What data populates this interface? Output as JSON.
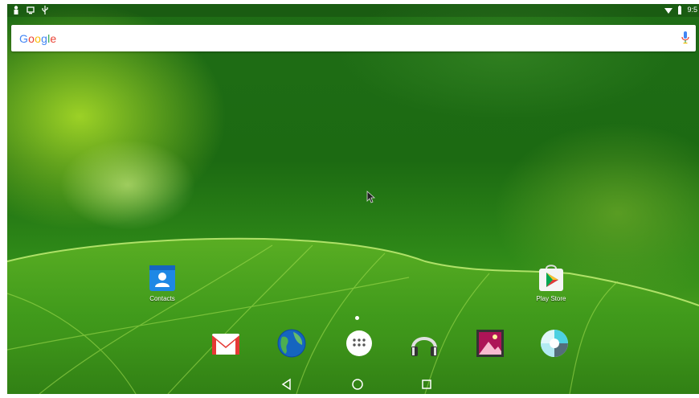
{
  "status_bar": {
    "left_icons": [
      "person-icon",
      "screen-icon",
      "usb-icon"
    ],
    "right_icons": [
      "wifi-icon",
      "battery-icon"
    ],
    "clock": "9:5"
  },
  "search_bar": {
    "logo": "Google",
    "logo_colors": [
      "#4285F4",
      "#EA4335",
      "#FBBC05",
      "#4285F4",
      "#34A853",
      "#EA4335"
    ],
    "mic_icon": "mic-icon"
  },
  "home_apps": [
    {
      "label": "Contacts",
      "icon": "contacts-icon"
    },
    {
      "label": "Play Store",
      "icon": "play-store-icon"
    }
  ],
  "dock": [
    {
      "icon": "gmail-icon"
    },
    {
      "icon": "browser-globe-icon"
    },
    {
      "icon": "app-drawer-icon"
    },
    {
      "icon": "headphones-music-icon"
    },
    {
      "icon": "gallery-icon"
    },
    {
      "icon": "camera-icon"
    }
  ],
  "nav_bar": [
    "back-icon",
    "home-icon",
    "recents-icon"
  ]
}
